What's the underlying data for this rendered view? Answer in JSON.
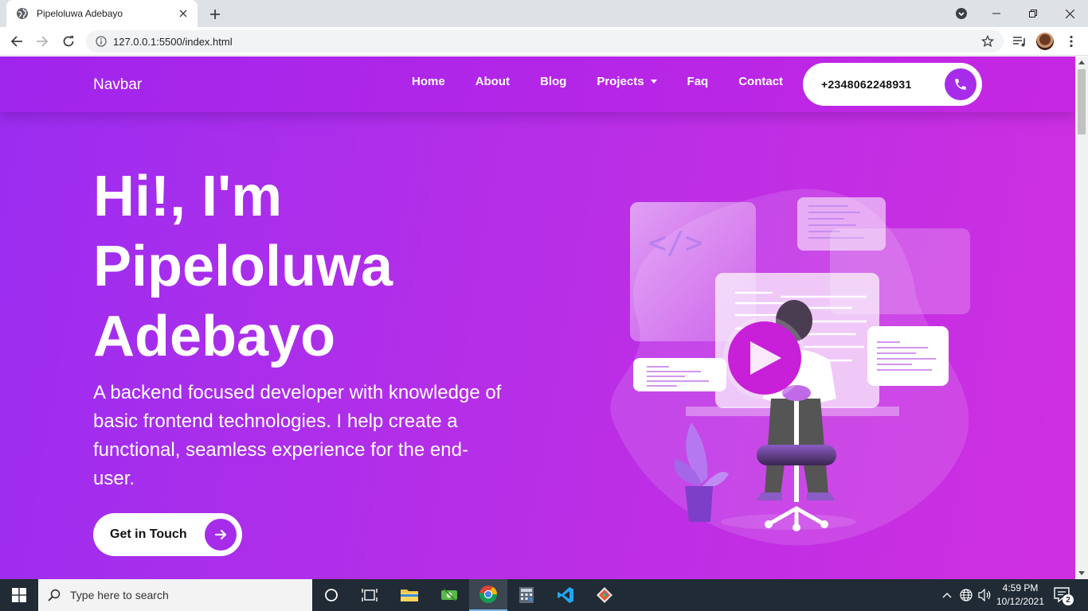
{
  "browser": {
    "tab_title": "Pipeloluwa Adebayo",
    "url": "127.0.0.1:5500/index.html"
  },
  "navbar": {
    "brand": "Navbar",
    "links": [
      "Home",
      "About",
      "Blog",
      "Projects",
      "Faq",
      "Contact"
    ],
    "phone": "+2348062248931"
  },
  "hero": {
    "title_lines": [
      "Hi!, I'm",
      "Pipeloluwa",
      "Adebayo"
    ],
    "description": "A backend focused developer with knowledge of basic frontend technologies. I help create a functional, seamless experience for the end-user.",
    "cta_label": "Get in Touch"
  },
  "illustration": {
    "code_tag": "</>"
  },
  "taskbar": {
    "search_placeholder": "Type here to search",
    "time": "4:59 PM",
    "date": "10/12/2021",
    "notification_count": "2"
  },
  "colors": {
    "accent": "#a62cea",
    "hero_gradient_start": "#9b2df0",
    "hero_gradient_end": "#cf2fe0",
    "play_button": "#c81fd8"
  }
}
